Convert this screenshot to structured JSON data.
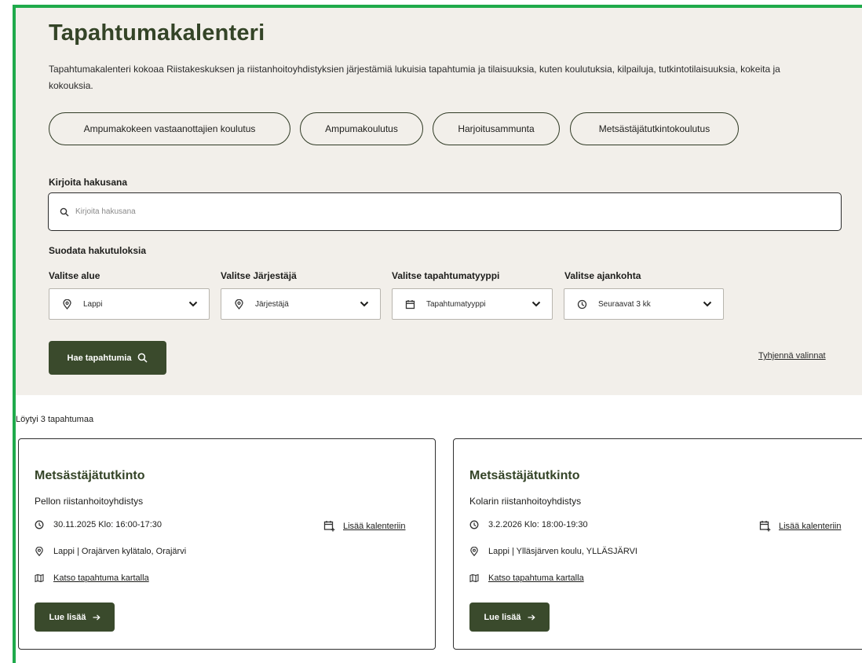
{
  "page": {
    "title": "Tapahtumakalenteri",
    "intro": "Tapahtumakalenteri kokoaa Riistakeskuksen ja riistanhoitoyhdistyksien järjestämiä lukuisia tapahtumia ja tilaisuuksia, kuten koulutuksia, kilpailuja, tutkintotilaisuuksia, kokeita ja kokouksia."
  },
  "categories": [
    "Ampumakokeen vastaanottajien koulutus",
    "Ampumakoulutus",
    "Harjoitusammunta",
    "Metsästäjätutkintokoulutus"
  ],
  "search": {
    "label": "Kirjoita hakusana",
    "placeholder": "Kirjoita hakusana",
    "value": ""
  },
  "filters": {
    "heading": "Suodata hakutuloksia",
    "area": {
      "label": "Valitse alue",
      "value": "Lappi",
      "icon": "location-pin-icon"
    },
    "organizer": {
      "label": "Valitse Järjestäjä",
      "value": "Järjestäjä",
      "icon": "location-pin-icon"
    },
    "event_type": {
      "label": "Valitse tapahtumatyyppi",
      "value": "Tapahtumatyyppi",
      "icon": "calendar-icon"
    },
    "time": {
      "label": "Valitse ajankohta",
      "value": "Seuraavat 3 kk",
      "icon": "clock-icon"
    }
  },
  "actions": {
    "search_button": "Hae tapahtumia",
    "clear_link": "Tyhjennä valinnat"
  },
  "results": {
    "count_text": "Löytyi 3 tapahtumaa",
    "cards": [
      {
        "title": "Metsästäjätutkinto",
        "organizer": "Pellon riistanhoitoyhdistys",
        "datetime": "30.11.2025 Klo: 16:00-17:30",
        "location": "Lappi | Orajärven kylätalo, Orajärvi",
        "map_link": "Katso tapahtuma kartalla",
        "add_calendar": "Lisää kalenteriin",
        "read_more": "Lue lisää"
      },
      {
        "title": "Metsästäjätutkinto",
        "organizer": "Kolarin riistanhoitoyhdistys",
        "datetime": "3.2.2026 Klo: 18:00-19:30",
        "location": "Lappi | Ylläsjärven koulu, YLLÄSJÄRVI",
        "map_link": "Katso tapahtuma kartalla",
        "add_calendar": "Lisää kalenteriin",
        "read_more": "Lue lisää"
      }
    ]
  },
  "colors": {
    "brand_dark_green": "#3a4a2c",
    "title_green": "#344427",
    "hero_bg": "#f2efea",
    "frame_green": "#1faa4b"
  }
}
